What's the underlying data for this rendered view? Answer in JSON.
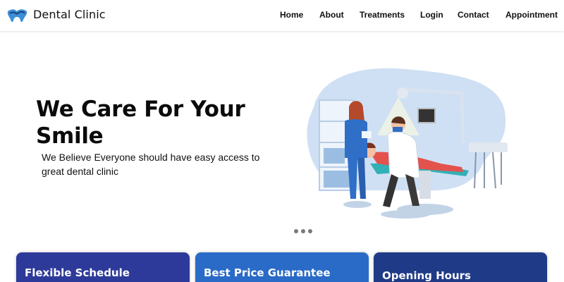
{
  "header": {
    "brand": "Dental Clinic",
    "logo_icon": "tooth-icon",
    "nav": [
      {
        "label": "Home"
      },
      {
        "label": "About"
      },
      {
        "label": "Treatments"
      },
      {
        "label": "Login"
      },
      {
        "label": "Contact"
      },
      {
        "label": "Appointment"
      }
    ]
  },
  "hero": {
    "title": "We Care For Your Smile",
    "subtitle": "We Believe Everyone should have easy access to great dental clinic",
    "illustration_icon": "dentist-illustration-icon"
  },
  "carousel": {
    "slides": 3
  },
  "cards": [
    {
      "title": "Flexible Schedule",
      "color": "#2e3a9a"
    },
    {
      "title": "Best Price Guarantee",
      "color": "#2a6bc7"
    },
    {
      "title": "Opening Hours",
      "color": "#1f3a86"
    }
  ],
  "colors": {
    "accent_blue": "#2a6bc7",
    "navy": "#1f3a86",
    "illustration_bg": "#cfe0f4"
  }
}
